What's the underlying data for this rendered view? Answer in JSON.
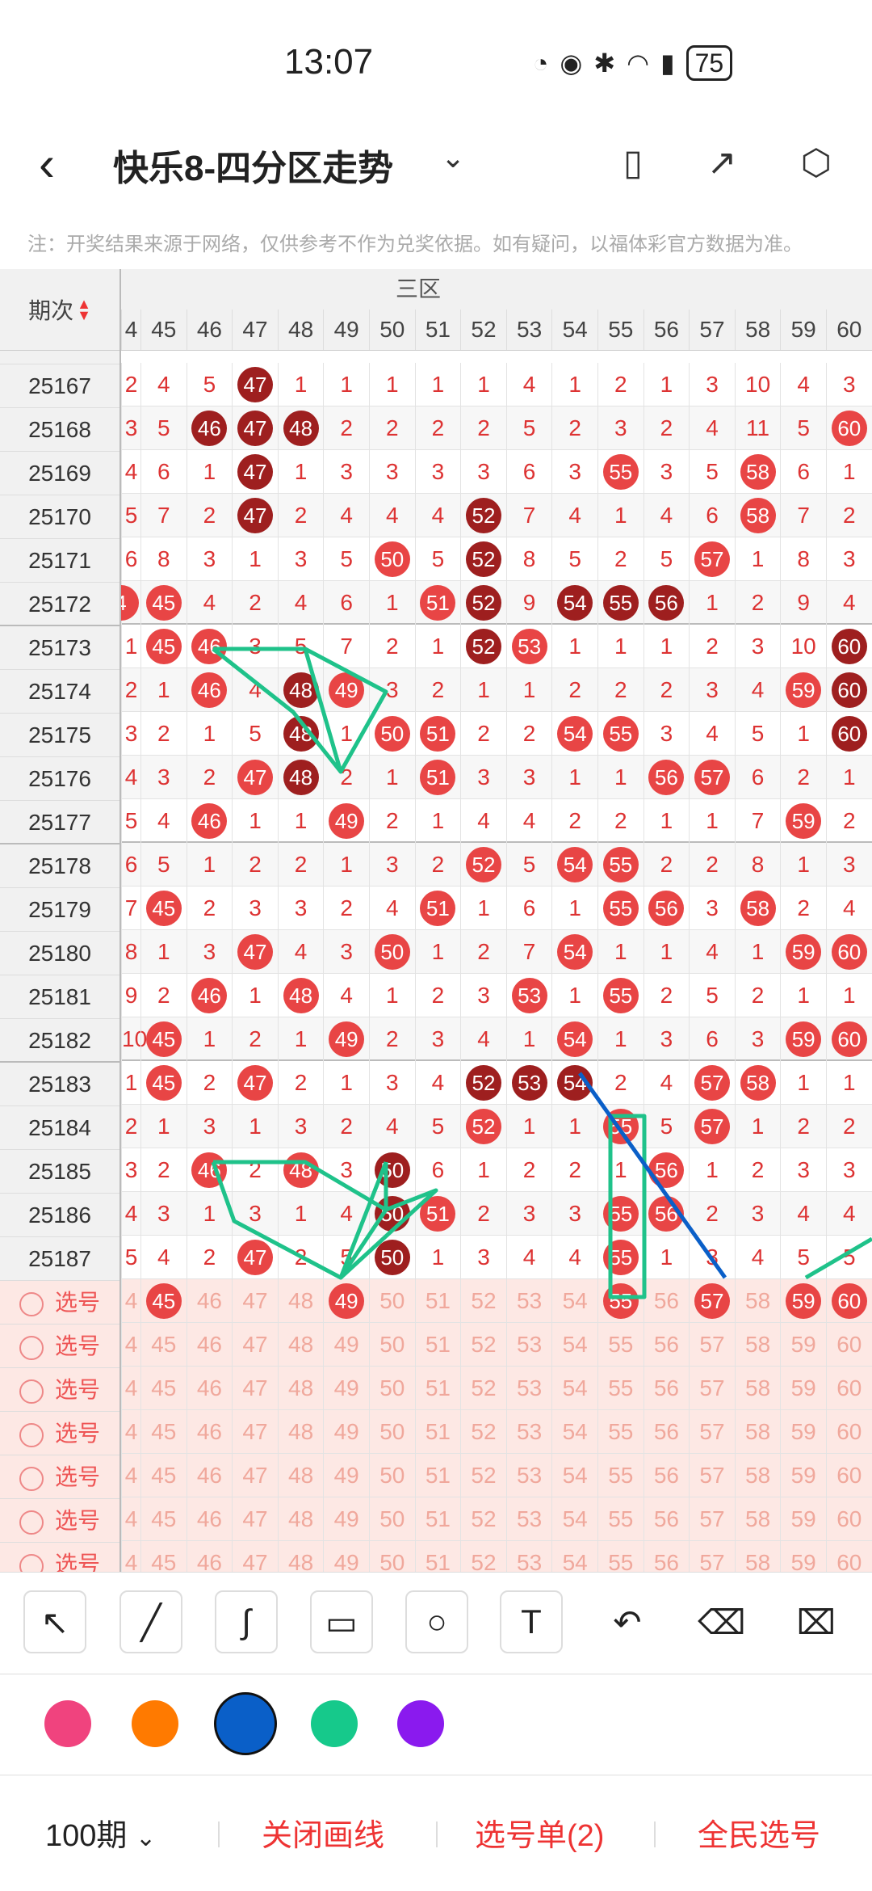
{
  "status": {
    "time": "13:07",
    "battery": "75"
  },
  "header": {
    "title": "快乐8-四分区走势",
    "back_icon": "back-arrow-icon",
    "chevron_icon": "chevron-down-icon"
  },
  "notice": "注：开奖结果来源于网络，仅供参考不作为兑奖依据。如有疑问，以福体彩官方数据为准。",
  "table": {
    "period_header": "期次",
    "zone_label": "三区",
    "columns": [
      "4",
      "45",
      "46",
      "47",
      "48",
      "49",
      "50",
      "51",
      "52",
      "53",
      "54",
      "55",
      "56",
      "57",
      "58",
      "59",
      "60"
    ],
    "rows": [
      {
        "period": "25167",
        "cells": [
          "2",
          "4",
          "5",
          "47",
          "1",
          "1",
          "1",
          "1",
          "1",
          "4",
          "1",
          "2",
          "1",
          "3",
          "10",
          "4",
          "3"
        ],
        "balls": {
          "3": "dark"
        }
      },
      {
        "period": "25168",
        "cells": [
          "3",
          "5",
          "46",
          "47",
          "48",
          "2",
          "2",
          "2",
          "2",
          "5",
          "2",
          "3",
          "2",
          "4",
          "11",
          "5",
          "60"
        ],
        "balls": {
          "2": "dark",
          "3": "dark",
          "4": "dark",
          "16": "red"
        }
      },
      {
        "period": "25169",
        "cells": [
          "4",
          "6",
          "1",
          "47",
          "1",
          "3",
          "3",
          "3",
          "3",
          "6",
          "3",
          "55",
          "3",
          "5",
          "58",
          "6",
          "1"
        ],
        "balls": {
          "3": "dark",
          "11": "red",
          "14": "red"
        }
      },
      {
        "period": "25170",
        "cells": [
          "5",
          "7",
          "2",
          "47",
          "2",
          "4",
          "4",
          "4",
          "52",
          "7",
          "4",
          "1",
          "4",
          "6",
          "58",
          "7",
          "2"
        ],
        "balls": {
          "3": "dark",
          "8": "dark",
          "14": "red"
        }
      },
      {
        "period": "25171",
        "cells": [
          "6",
          "8",
          "3",
          "1",
          "3",
          "5",
          "50",
          "5",
          "52",
          "8",
          "5",
          "2",
          "5",
          "57",
          "1",
          "8",
          "3"
        ],
        "balls": {
          "6": "red",
          "8": "dark",
          "13": "red"
        }
      },
      {
        "period": "25172",
        "cells": [
          "4",
          "45",
          "4",
          "2",
          "4",
          "6",
          "1",
          "51",
          "52",
          "9",
          "54",
          "55",
          "56",
          "1",
          "2",
          "9",
          "4"
        ],
        "balls": {
          "0": "red",
          "1": "red",
          "7": "red",
          "8": "dark",
          "10": "dark",
          "11": "dark",
          "12": "dark"
        },
        "sep": true
      },
      {
        "period": "25173",
        "cells": [
          "1",
          "45",
          "46",
          "3",
          "5",
          "7",
          "2",
          "1",
          "52",
          "53",
          "1",
          "1",
          "1",
          "2",
          "3",
          "10",
          "60"
        ],
        "balls": {
          "1": "red",
          "2": "red",
          "8": "dark",
          "9": "red",
          "16": "dark"
        }
      },
      {
        "period": "25174",
        "cells": [
          "2",
          "1",
          "46",
          "4",
          "48",
          "49",
          "3",
          "2",
          "1",
          "1",
          "2",
          "2",
          "2",
          "3",
          "4",
          "59",
          "60"
        ],
        "balls": {
          "2": "red",
          "4": "dark",
          "5": "red",
          "15": "red",
          "16": "dark"
        }
      },
      {
        "period": "25175",
        "cells": [
          "3",
          "2",
          "1",
          "5",
          "48",
          "1",
          "50",
          "51",
          "2",
          "2",
          "54",
          "55",
          "3",
          "4",
          "5",
          "1",
          "60"
        ],
        "balls": {
          "4": "dark",
          "6": "red",
          "7": "red",
          "10": "red",
          "11": "red",
          "16": "dark"
        }
      },
      {
        "period": "25176",
        "cells": [
          "4",
          "3",
          "2",
          "47",
          "48",
          "2",
          "1",
          "51",
          "3",
          "3",
          "1",
          "1",
          "56",
          "57",
          "6",
          "2",
          "1"
        ],
        "balls": {
          "3": "red",
          "4": "dark",
          "7": "red",
          "12": "red",
          "13": "red"
        }
      },
      {
        "period": "25177",
        "cells": [
          "5",
          "4",
          "46",
          "1",
          "1",
          "49",
          "2",
          "1",
          "4",
          "4",
          "2",
          "2",
          "1",
          "1",
          "7",
          "59",
          "2"
        ],
        "balls": {
          "2": "red",
          "5": "red",
          "15": "red"
        },
        "sep": true
      },
      {
        "period": "25178",
        "cells": [
          "6",
          "5",
          "1",
          "2",
          "2",
          "1",
          "3",
          "2",
          "52",
          "5",
          "54",
          "55",
          "2",
          "2",
          "8",
          "1",
          "3"
        ],
        "balls": {
          "8": "red",
          "10": "red",
          "11": "red"
        }
      },
      {
        "period": "25179",
        "cells": [
          "7",
          "45",
          "2",
          "3",
          "3",
          "2",
          "4",
          "51",
          "1",
          "6",
          "1",
          "55",
          "56",
          "3",
          "58",
          "2",
          "4"
        ],
        "balls": {
          "1": "red",
          "7": "red",
          "11": "red",
          "12": "red",
          "14": "red"
        }
      },
      {
        "period": "25180",
        "cells": [
          "8",
          "1",
          "3",
          "47",
          "4",
          "3",
          "50",
          "1",
          "2",
          "7",
          "54",
          "1",
          "1",
          "4",
          "1",
          "59",
          "60"
        ],
        "balls": {
          "3": "red",
          "6": "red",
          "10": "red",
          "15": "red",
          "16": "red"
        }
      },
      {
        "period": "25181",
        "cells": [
          "9",
          "2",
          "46",
          "1",
          "48",
          "4",
          "1",
          "2",
          "3",
          "53",
          "1",
          "55",
          "2",
          "5",
          "2",
          "1",
          "1"
        ],
        "balls": {
          "2": "red",
          "4": "red",
          "9": "red",
          "11": "red"
        }
      },
      {
        "period": "25182",
        "cells": [
          "10",
          "45",
          "1",
          "2",
          "1",
          "49",
          "2",
          "3",
          "4",
          "1",
          "54",
          "1",
          "3",
          "6",
          "3",
          "59",
          "60"
        ],
        "balls": {
          "1": "red",
          "5": "red",
          "10": "red",
          "15": "red",
          "16": "red"
        },
        "sep": true
      },
      {
        "period": "25183",
        "cells": [
          "1",
          "45",
          "2",
          "47",
          "2",
          "1",
          "3",
          "4",
          "52",
          "53",
          "54",
          "2",
          "4",
          "57",
          "58",
          "1",
          "1"
        ],
        "balls": {
          "1": "red",
          "3": "red",
          "8": "dark",
          "9": "dark",
          "10": "dark",
          "13": "red",
          "14": "red"
        }
      },
      {
        "period": "25184",
        "cells": [
          "2",
          "1",
          "3",
          "1",
          "3",
          "2",
          "4",
          "5",
          "52",
          "1",
          "1",
          "55",
          "5",
          "57",
          "1",
          "2",
          "2"
        ],
        "balls": {
          "8": "red",
          "11": "red",
          "13": "red"
        }
      },
      {
        "period": "25185",
        "cells": [
          "3",
          "2",
          "46",
          "2",
          "48",
          "3",
          "50",
          "6",
          "1",
          "2",
          "2",
          "1",
          "56",
          "1",
          "2",
          "3",
          "3"
        ],
        "balls": {
          "2": "red",
          "4": "red",
          "6": "dark",
          "12": "red"
        }
      },
      {
        "period": "25186",
        "cells": [
          "4",
          "3",
          "1",
          "3",
          "1",
          "4",
          "50",
          "51",
          "2",
          "3",
          "3",
          "55",
          "56",
          "2",
          "3",
          "4",
          "4"
        ],
        "balls": {
          "6": "dark",
          "7": "red",
          "11": "red",
          "12": "red"
        }
      },
      {
        "period": "25187",
        "cells": [
          "5",
          "4",
          "2",
          "47",
          "2",
          "5",
          "50",
          "1",
          "3",
          "4",
          "4",
          "55",
          "1",
          "3",
          "4",
          "5",
          "5"
        ],
        "balls": {
          "3": "red",
          "6": "dark",
          "11": "red"
        }
      }
    ],
    "pick_label": "选号",
    "pick_rows": [
      {
        "cells": [
          "4",
          "45",
          "46",
          "47",
          "48",
          "49",
          "50",
          "51",
          "52",
          "53",
          "54",
          "55",
          "56",
          "57",
          "58",
          "59",
          "60"
        ],
        "balls": {
          "1": "red",
          "5": "red",
          "11": "red",
          "13": "red",
          "15": "red",
          "16": "red"
        }
      },
      {
        "cells": [
          "4",
          "45",
          "46",
          "47",
          "48",
          "49",
          "50",
          "51",
          "52",
          "53",
          "54",
          "55",
          "56",
          "57",
          "58",
          "59",
          "60"
        ],
        "balls": {}
      },
      {
        "cells": [
          "4",
          "45",
          "46",
          "47",
          "48",
          "49",
          "50",
          "51",
          "52",
          "53",
          "54",
          "55",
          "56",
          "57",
          "58",
          "59",
          "60"
        ],
        "balls": {}
      },
      {
        "cells": [
          "4",
          "45",
          "46",
          "47",
          "48",
          "49",
          "50",
          "51",
          "52",
          "53",
          "54",
          "55",
          "56",
          "57",
          "58",
          "59",
          "60"
        ],
        "balls": {}
      },
      {
        "cells": [
          "4",
          "45",
          "46",
          "47",
          "48",
          "49",
          "50",
          "51",
          "52",
          "53",
          "54",
          "55",
          "56",
          "57",
          "58",
          "59",
          "60"
        ],
        "balls": {}
      },
      {
        "cells": [
          "4",
          "45",
          "46",
          "47",
          "48",
          "49",
          "50",
          "51",
          "52",
          "53",
          "54",
          "55",
          "56",
          "57",
          "58",
          "59",
          "60"
        ],
        "balls": {}
      },
      {
        "cells": [
          "4",
          "45",
          "46",
          "47",
          "48",
          "49",
          "50",
          "51",
          "52",
          "53",
          "54",
          "55",
          "56",
          "57",
          "58",
          "59",
          "60"
        ],
        "balls": {}
      }
    ]
  },
  "tools": [
    "arrow-tool-icon",
    "line-tool-icon",
    "curve-tool-icon",
    "rectangle-tool-icon",
    "circle-tool-icon",
    "text-tool-icon",
    "undo-icon",
    "eraser-icon",
    "clear-icon"
  ],
  "colors": [
    "#f0437e",
    "#ff7a00",
    "#0a5fc8",
    "#16c98b",
    "#8a1aee"
  ],
  "selected_color": "#0a5fc8",
  "bottom": {
    "periods": "100期",
    "close_draw": "关闭画线",
    "pick_list": "选号单(2)",
    "all_pick": "全民选号"
  }
}
